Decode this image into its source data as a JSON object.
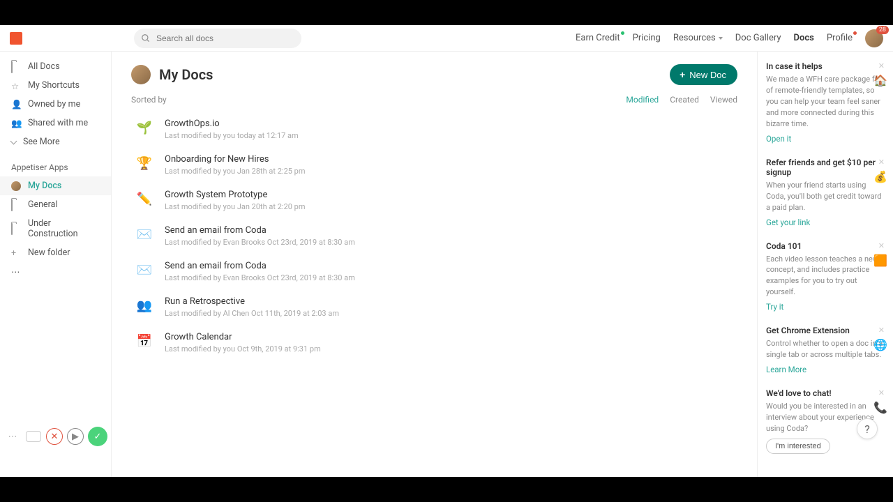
{
  "search": {
    "placeholder": "Search all docs"
  },
  "topnav": {
    "earn_credit": "Earn Credit",
    "pricing": "Pricing",
    "resources": "Resources",
    "doc_gallery": "Doc Gallery",
    "docs": "Docs",
    "profile": "Profile",
    "avatar_badge": "28"
  },
  "sidebar": {
    "items": [
      {
        "label": "All Docs"
      },
      {
        "label": "My Shortcuts"
      },
      {
        "label": "Owned by me"
      },
      {
        "label": "Shared with me"
      },
      {
        "label": "See More"
      }
    ],
    "section": "Appetiser Apps",
    "ws_items": [
      {
        "label": "My Docs"
      },
      {
        "label": "General"
      },
      {
        "label": "Under Construction"
      },
      {
        "label": "New folder"
      }
    ]
  },
  "page": {
    "title": "My Docs",
    "new_doc": "New Doc",
    "sorted_by": "Sorted by",
    "sort": {
      "modified": "Modified",
      "created": "Created",
      "viewed": "Viewed"
    }
  },
  "docs": [
    {
      "icon": "🌱",
      "title": "GrowthOps.io",
      "meta": "Last modified by you today at 12:17 am"
    },
    {
      "icon": "🏆",
      "title": "Onboarding for New Hires",
      "meta": "Last modified by you Jan 28th at 2:25 pm"
    },
    {
      "icon": "✏️",
      "title": "Growth System Prototype",
      "meta": "Last modified by you Jan 20th at 2:20 pm"
    },
    {
      "icon": "✉️",
      "title": "Send an email from Coda",
      "meta": "Last modified by Evan Brooks Oct 23rd, 2019 at 8:30 am"
    },
    {
      "icon": "✉️",
      "title": "Send an email from Coda",
      "meta": "Last modified by Evan Brooks Oct 23rd, 2019 at 8:30 am"
    },
    {
      "icon": "👥",
      "title": "Run a Retrospective",
      "meta": "Last modified by Al Chen Oct 11th, 2019 at 2:03 am"
    },
    {
      "icon": "📅",
      "title": "Growth Calendar",
      "meta": "Last modified by you Oct 9th, 2019 at 9:31 pm"
    }
  ],
  "cards": [
    {
      "title": "In case it helps",
      "body": "We made a WFH care package full of remote-friendly templates, so you can help your team feel saner and more connected during this bizarre time.",
      "link": "Open it",
      "icon": "🏠"
    },
    {
      "title": "Refer friends and get $10 per signup",
      "body": "When your friend starts using Coda, you'll both get credit toward a paid plan.",
      "link": "Get your link",
      "icon": "💰"
    },
    {
      "title": "Coda 101",
      "body": "Each video lesson teaches a new concept, and includes practice examples for you to try out yourself.",
      "link": "Try it",
      "icon": "🟧"
    },
    {
      "title": "Get Chrome Extension",
      "body": "Control whether to open a doc in a single tab or across multiple tabs.",
      "link": "Learn More",
      "icon": "🌐"
    },
    {
      "title": "We'd love to chat!",
      "body": "Would you be interested in an interview about your experience using Coda?",
      "button": "I'm interested",
      "icon": "📞"
    }
  ]
}
